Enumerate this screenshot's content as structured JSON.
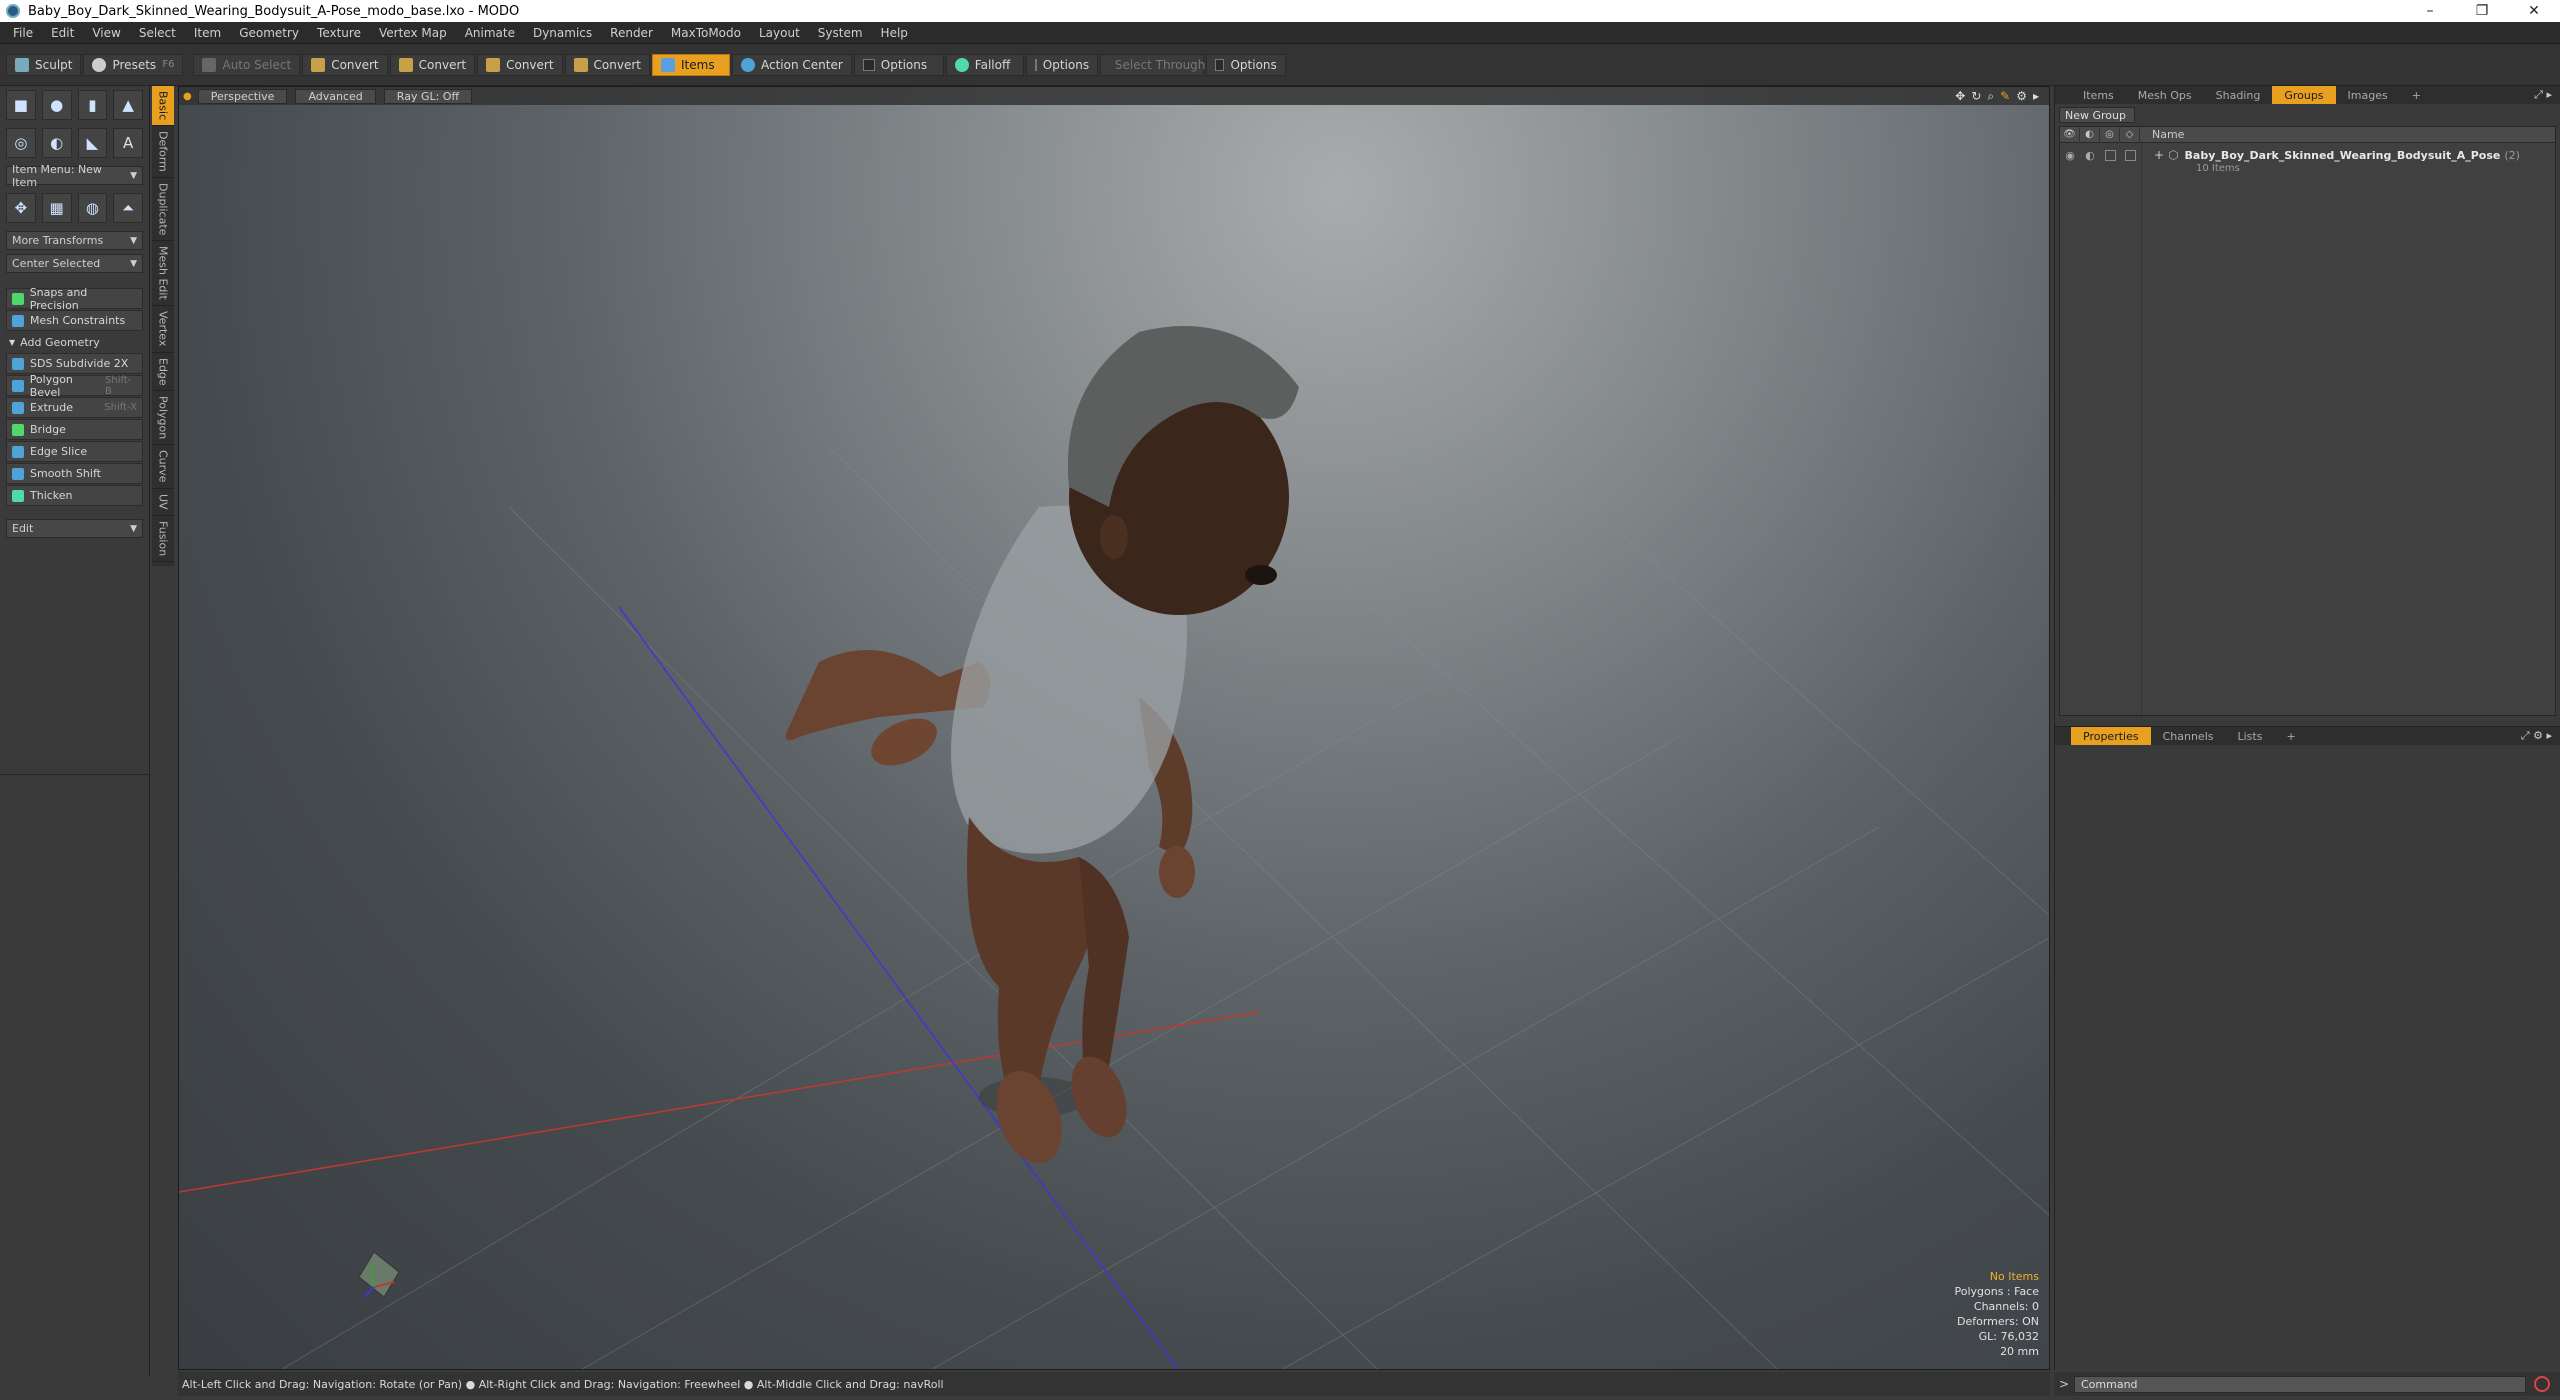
{
  "window": {
    "title": "Baby_Boy_Dark_Skinned_Wearing_Bodysuit_A-Pose_modo_base.lxo - MODO",
    "minimize": "–",
    "maximize": "❐",
    "close": "✕"
  },
  "menu": [
    "File",
    "Edit",
    "View",
    "Select",
    "Item",
    "Geometry",
    "Texture",
    "Vertex Map",
    "Animate",
    "Dynamics",
    "Render",
    "MaxToModo",
    "Layout",
    "System",
    "Help"
  ],
  "toolbar": {
    "sculpt": "Sculpt",
    "presets": "Presets",
    "presets_shortcut": "F6",
    "auto_select": "Auto Select",
    "convert1": "Convert",
    "convert2": "Convert",
    "convert3": "Convert",
    "convert4": "Convert",
    "items": "Items",
    "action_center": "Action Center",
    "options1": "Options",
    "falloff": "Falloff",
    "options2": "Options",
    "select_through": "Select Through",
    "options3": "Options"
  },
  "left": {
    "item_menu": "Item Menu: New Item",
    "more_transforms": "More Transforms",
    "center_selected": "Center Selected",
    "snaps": "Snaps and Precision",
    "mesh_constraints": "Mesh Constraints",
    "add_geometry": "Add Geometry",
    "tools": [
      {
        "label": "SDS Subdivide 2X",
        "shortcut": "",
        "color": "#4fa3d9"
      },
      {
        "label": "Polygon Bevel",
        "shortcut": "Shift-B",
        "color": "#4fa3d9"
      },
      {
        "label": "Extrude",
        "shortcut": "Shift-X",
        "color": "#4fa3d9"
      },
      {
        "label": "Bridge",
        "shortcut": "",
        "color": "#4fd96a"
      },
      {
        "label": "Edge Slice",
        "shortcut": "",
        "color": "#4fa3d9"
      },
      {
        "label": "Smooth Shift",
        "shortcut": "",
        "color": "#4fa3d9"
      },
      {
        "label": "Thicken",
        "shortcut": "",
        "color": "#4fd9b0"
      }
    ],
    "edit": "Edit"
  },
  "vtabs": [
    "Basic",
    "Deform",
    "Duplicate",
    "Mesh Edit",
    "Vertex",
    "Edge",
    "Polygon",
    "Curve",
    "UV",
    "Fusion"
  ],
  "viewport": {
    "perspective": "Perspective",
    "advanced": "Advanced",
    "raygl": "Ray GL: Off",
    "info": {
      "no_items": "No Items",
      "polygons": "Polygons : Face",
      "channels": "Channels: 0",
      "deformers": "Deformers: ON",
      "gl": "GL: 76,032",
      "mm": "20 mm"
    }
  },
  "right_top": {
    "tabs": [
      "Items",
      "Mesh Ops",
      "Shading",
      "Groups",
      "Images"
    ],
    "active_tab": "Groups",
    "plus": "+",
    "new_group": "New Group",
    "col_name": "Name",
    "group_name": "Baby_Boy_Dark_Skinned_Wearing_Bodysuit_A_Pose",
    "group_count": "(2)",
    "group_items": "10 Items"
  },
  "right_bottom": {
    "tabs": [
      "Properties",
      "Channels",
      "Lists"
    ],
    "active_tab": "Properties",
    "plus": "+"
  },
  "status": "Alt-Left Click and Drag: Navigation: Rotate (or Pan) ● Alt-Right Click and Drag: Navigation: Freewheel ● Alt-Middle Click and Drag: navRoll",
  "command": {
    "prompt": ">",
    "placeholder": "Command"
  },
  "colors": {
    "accent": "#e8a020",
    "x_axis": "#c0392b",
    "z_axis": "#3a3ad0",
    "skin": "#5b3a28"
  }
}
